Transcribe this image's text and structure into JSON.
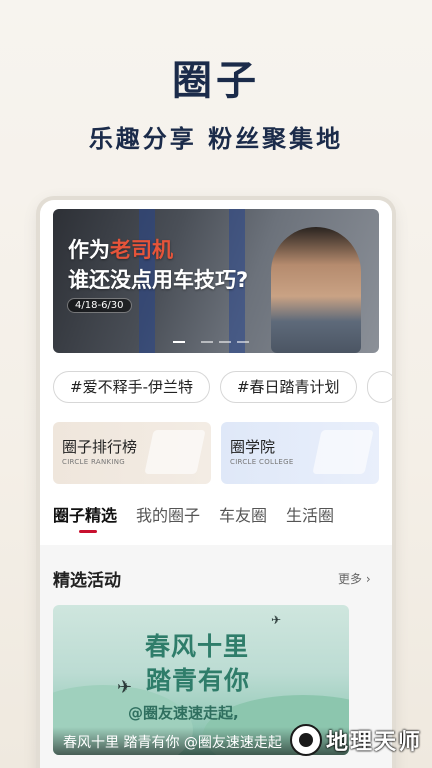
{
  "promo": {
    "title": "圈子",
    "subtitle": "乐趣分享  粉丝聚集地"
  },
  "banner": {
    "line1_prefix": "作为",
    "line1_accent": "老司机",
    "line2": "谁还没点用车技巧?",
    "date": "4/18-6/30",
    "page_count": 4,
    "active_index": 0
  },
  "tags": [
    "#爱不释手-伊兰特",
    "#春日踏青计划"
  ],
  "cards": [
    {
      "title": "圈子排行榜",
      "subtitle": "CIRCLE RANKING"
    },
    {
      "title": "圈学院",
      "subtitle": "CIRCLE COLLEGE"
    }
  ],
  "tabs": [
    "圈子精选",
    "我的圈子",
    "车友圈",
    "生活圈"
  ],
  "active_tab": 0,
  "section": {
    "title": "精选活动",
    "more_label": "更多 ›"
  },
  "activity": {
    "line1": "春风十里",
    "line2": "踏青有你",
    "hashtag": "@圈友速速走起,",
    "caption": "春风十里 踏青有你 @圈友速速走起"
  },
  "watermark": {
    "text": "地理天师"
  },
  "colors": {
    "brand_navy": "#1b2b4a",
    "tab_indicator": "#c8102e",
    "banner_accent": "#e6543a"
  }
}
